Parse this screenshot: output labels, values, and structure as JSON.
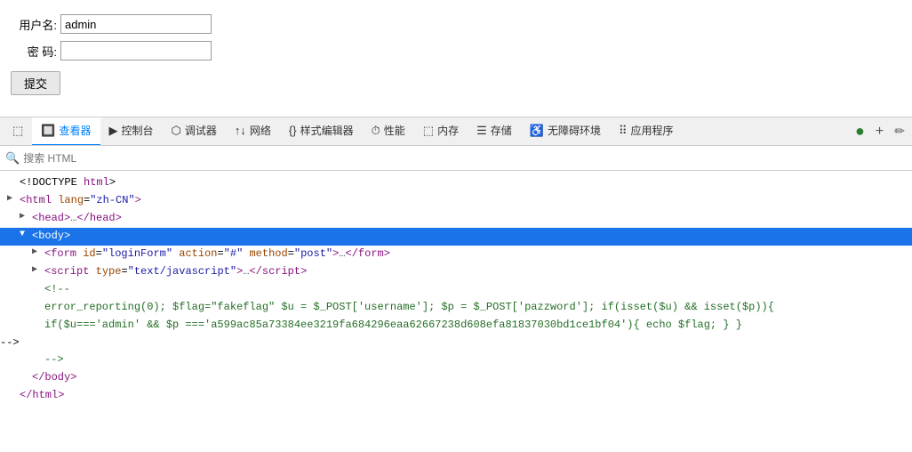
{
  "form": {
    "username_label": "用户名:",
    "password_label": "密 码:",
    "username_value": "admin",
    "password_value": "",
    "submit_label": "提交"
  },
  "devtools": {
    "tabs": [
      {
        "id": "source",
        "icon": "⬚",
        "label": ""
      },
      {
        "id": "inspector",
        "icon": "🔲",
        "label": "查看器",
        "active": true
      },
      {
        "id": "console",
        "icon": "▶",
        "label": "控制台"
      },
      {
        "id": "debugger",
        "icon": "⬡",
        "label": "调试器"
      },
      {
        "id": "network",
        "icon": "↑↓",
        "label": "网络"
      },
      {
        "id": "style-editor",
        "icon": "{}",
        "label": "样式编辑器"
      },
      {
        "id": "performance",
        "icon": "⏱",
        "label": "性能"
      },
      {
        "id": "memory",
        "icon": "⬚",
        "label": "内存"
      },
      {
        "id": "storage",
        "icon": "☰",
        "label": "存储"
      },
      {
        "id": "accessibility",
        "icon": "♿",
        "label": "无障碍环境"
      },
      {
        "id": "apps",
        "icon": "⠿",
        "label": "应用程序"
      },
      {
        "id": "more",
        "icon": "●",
        "label": ""
      }
    ],
    "search_placeholder": "搜索 HTML",
    "html_lines": [
      {
        "id": 1,
        "indent": 0,
        "toggle": "none",
        "content": "<!DOCTYPE html>",
        "type": "doctype"
      },
      {
        "id": 2,
        "indent": 0,
        "toggle": "collapsed",
        "content": "<html lang=\"zh-CN\">",
        "type": "tag"
      },
      {
        "id": 3,
        "indent": 1,
        "toggle": "collapsed",
        "content": "<head>…</head>",
        "type": "tag-collapsed"
      },
      {
        "id": 4,
        "indent": 1,
        "toggle": "expanded",
        "content": "<body>",
        "type": "tag",
        "selected": true
      },
      {
        "id": 5,
        "indent": 2,
        "toggle": "collapsed",
        "content": "<form id=\"loginForm\" action=\"#\" method=\"post\">…</form>",
        "type": "tag-collapsed"
      },
      {
        "id": 6,
        "indent": 2,
        "toggle": "collapsed",
        "content": "<script type=\"text/javascript\">…<\\/script>",
        "type": "tag-collapsed"
      },
      {
        "id": 7,
        "indent": 2,
        "toggle": "none",
        "content": "<!--",
        "type": "comment"
      },
      {
        "id": 8,
        "indent": 3,
        "toggle": "none",
        "content": "error_reporting(0); $flag=\"fakeflag\" $u = $_POST['username']; $p = $_POST['pazzword']; if(isset($u) && isset($p)){",
        "type": "php"
      },
      {
        "id": 9,
        "indent": 3,
        "toggle": "none",
        "content": "if($u==='admin' && $p ==='a599ac85a73384ee3219fa684296eaa62667238d608efa81837030bd1ce1bf04'){ echo $flag; } }",
        "type": "php"
      },
      {
        "id": 10,
        "indent": 2,
        "toggle": "none",
        "content": "-->",
        "type": "comment"
      },
      {
        "id": 11,
        "indent": 1,
        "toggle": "none",
        "content": "</body>",
        "type": "tag"
      },
      {
        "id": 12,
        "indent": 0,
        "toggle": "none",
        "content": "</html>",
        "type": "tag"
      }
    ]
  }
}
